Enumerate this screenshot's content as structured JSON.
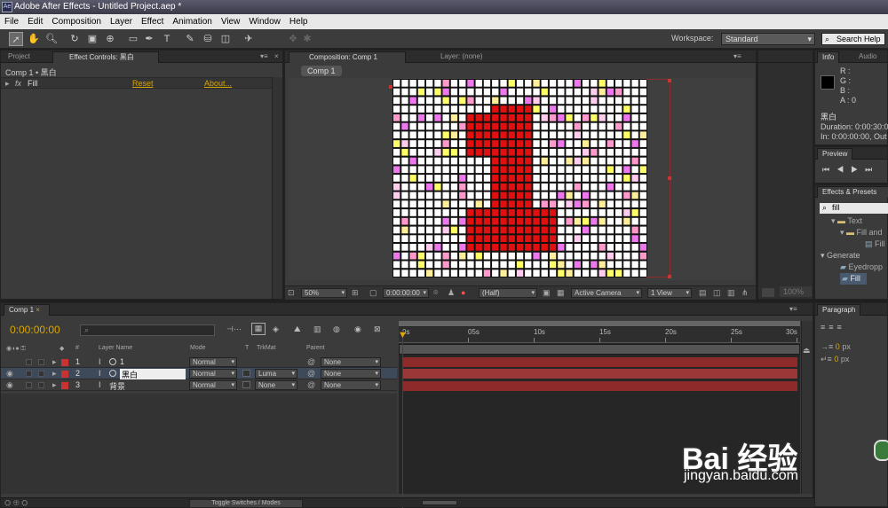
{
  "app": {
    "title": "Adobe After Effects - Untitled Project.aep *",
    "icon": "Ae"
  },
  "menu": [
    "File",
    "Edit",
    "Composition",
    "Layer",
    "Effect",
    "Animation",
    "View",
    "Window",
    "Help"
  ],
  "toolbar": {
    "workspace_label": "Workspace:",
    "workspace_value": "Standard",
    "search_placeholder": "Search Help"
  },
  "project_panel": {
    "tabs": [
      "Project",
      "Effect Controls: 黑白"
    ],
    "breadcrumb": "Comp 1 • 黑白",
    "effect": {
      "name": "Fill",
      "reset": "Reset",
      "about": "About..."
    }
  },
  "composition_panel": {
    "tabs": [
      "Composition: Comp 1",
      "Layer: (none)"
    ],
    "comp_tab": "Comp 1",
    "footer": {
      "zoom": "50%",
      "timecode": "0:00:00:00",
      "resolution": "(Half)",
      "camera": "Active Camera",
      "view": "1 View"
    }
  },
  "info_panel": {
    "tabs": [
      "Info",
      "Audio"
    ],
    "rgb": [
      "R :",
      "G :",
      "B :",
      "A : 0"
    ],
    "layer_name": "黑白",
    "duration": "Duration: 0:00:30:0",
    "in_out": "In: 0:00:00:00, Out"
  },
  "preview_panel": {
    "title": "Preview",
    "zoom_readout": "100%"
  },
  "effects_presets": {
    "title": "Effects & Presets",
    "search": "fill",
    "items": [
      "Text",
      "Fill and",
      "Fill",
      "Generate",
      "Eyedropp",
      "Fill"
    ]
  },
  "timeline": {
    "tab": "Comp 1",
    "timecode": "0:00:00:00",
    "headers": {
      "layer_name": "Layer Name",
      "mode": "Mode",
      "t": "T",
      "trkmat": "TrkMat",
      "parent": "Parent",
      "num": "#"
    },
    "layers": [
      {
        "num": "1",
        "name": "1",
        "mode": "Normal",
        "trkmat": "",
        "parent": "None"
      },
      {
        "num": "2",
        "name": "黑白",
        "mode": "Normal",
        "trkmat": "Luma",
        "parent": "None"
      },
      {
        "num": "3",
        "name": "背景",
        "mode": "Normal",
        "trkmat": "None",
        "parent": "None"
      }
    ],
    "ruler": [
      "0s",
      "05s",
      "10s",
      "15s",
      "20s",
      "25s",
      "30s"
    ],
    "toggle_label": "Toggle Switches / Modes"
  },
  "paragraph_panel": {
    "title": "Paragraph",
    "px1": "px",
    "px2": "px"
  },
  "watermark": {
    "brand": "Bai 经验",
    "url": "jingyan.baidu.com"
  },
  "colors": {
    "accent_orange": "#d8a600",
    "layer_red": "#c83232",
    "bar_red": "#8d2a2a",
    "grid_red": "#e01010"
  }
}
